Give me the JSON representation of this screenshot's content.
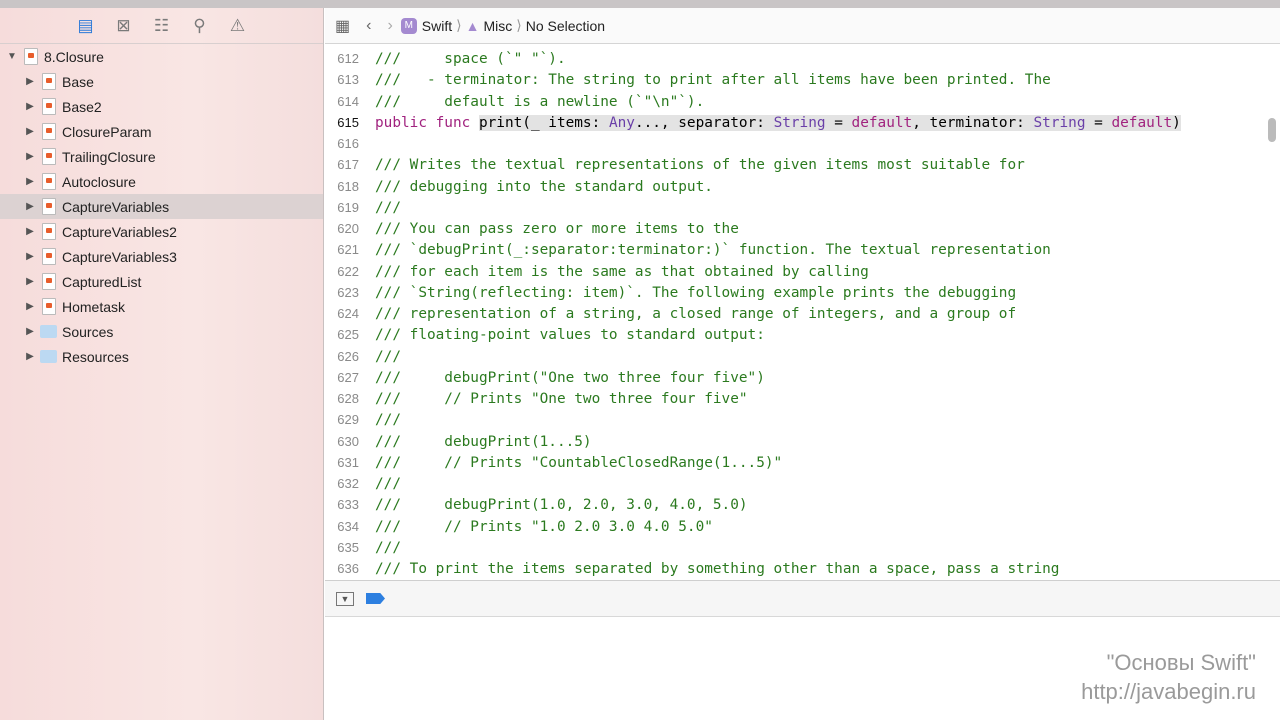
{
  "navigator": {
    "icons": [
      "folder-icon",
      "source-control-icon",
      "hierarchy-icon",
      "search-icon",
      "warning-icon"
    ]
  },
  "tree": {
    "root": "8.Closure",
    "items": [
      {
        "label": "Base",
        "type": "page"
      },
      {
        "label": "Base2",
        "type": "page"
      },
      {
        "label": "ClosureParam",
        "type": "page"
      },
      {
        "label": "TrailingClosure",
        "type": "page"
      },
      {
        "label": "Autoclosure",
        "type": "page"
      },
      {
        "label": "CaptureVariables",
        "type": "page",
        "selected": true
      },
      {
        "label": "CaptureVariables2",
        "type": "page"
      },
      {
        "label": "CaptureVariables3",
        "type": "page"
      },
      {
        "label": "CapturedList",
        "type": "page"
      },
      {
        "label": "Hometask",
        "type": "page"
      },
      {
        "label": "Sources",
        "type": "folder"
      },
      {
        "label": "Resources",
        "type": "folder"
      }
    ]
  },
  "jumpbar": {
    "badge": "M",
    "module": "Swift",
    "group": "Misc",
    "selection": "No Selection"
  },
  "code": {
    "current_line": "615",
    "lines": [
      {
        "n": "612",
        "t": "///     space (`\" \"`)."
      },
      {
        "n": "613",
        "t": "///   - terminator: The string to print after all items have been printed. The"
      },
      {
        "n": "614",
        "t": "///     default is a newline (`\"\\n\"`)."
      },
      {
        "n": "615",
        "tokens": [
          [
            "kw",
            "public func "
          ],
          [
            "hl",
            ""
          ],
          [
            "p",
            "print(_ items: "
          ],
          [
            "ty",
            "Any"
          ],
          [
            "p",
            "..., separator: "
          ],
          [
            "ty",
            "String"
          ],
          [
            "p",
            " = "
          ],
          [
            "kw",
            "default"
          ],
          [
            "p",
            ", terminator: "
          ],
          [
            "ty",
            "String"
          ],
          [
            "p",
            " = "
          ],
          [
            "kw",
            "default"
          ],
          [
            "p",
            ")"
          ]
        ]
      },
      {
        "n": "616",
        "t": ""
      },
      {
        "n": "617",
        "t": "/// Writes the textual representations of the given items most suitable for"
      },
      {
        "n": "618",
        "t": "/// debugging into the standard output."
      },
      {
        "n": "619",
        "t": "///"
      },
      {
        "n": "620",
        "t": "/// You can pass zero or more items to the"
      },
      {
        "n": "621",
        "t": "/// `debugPrint(_:separator:terminator:)` function. The textual representation"
      },
      {
        "n": "622",
        "t": "/// for each item is the same as that obtained by calling"
      },
      {
        "n": "623",
        "t": "/// `String(reflecting: item)`. The following example prints the debugging"
      },
      {
        "n": "624",
        "t": "/// representation of a string, a closed range of integers, and a group of"
      },
      {
        "n": "625",
        "t": "/// floating-point values to standard output:"
      },
      {
        "n": "626",
        "t": "///"
      },
      {
        "n": "627",
        "t": "///     debugPrint(\"One two three four five\")"
      },
      {
        "n": "628",
        "t": "///     // Prints \"One two three four five\""
      },
      {
        "n": "629",
        "t": "///"
      },
      {
        "n": "630",
        "t": "///     debugPrint(1...5)"
      },
      {
        "n": "631",
        "t": "///     // Prints \"CountableClosedRange(1...5)\""
      },
      {
        "n": "632",
        "t": "///"
      },
      {
        "n": "633",
        "t": "///     debugPrint(1.0, 2.0, 3.0, 4.0, 5.0)"
      },
      {
        "n": "634",
        "t": "///     // Prints \"1.0 2.0 3.0 4.0 5.0\""
      },
      {
        "n": "635",
        "t": "///"
      },
      {
        "n": "636",
        "t": "/// To print the items separated by something other than a space, pass a string"
      }
    ]
  },
  "watermark": {
    "line1": "\"Основы Swift\"",
    "line2": "http://javabegin.ru"
  }
}
